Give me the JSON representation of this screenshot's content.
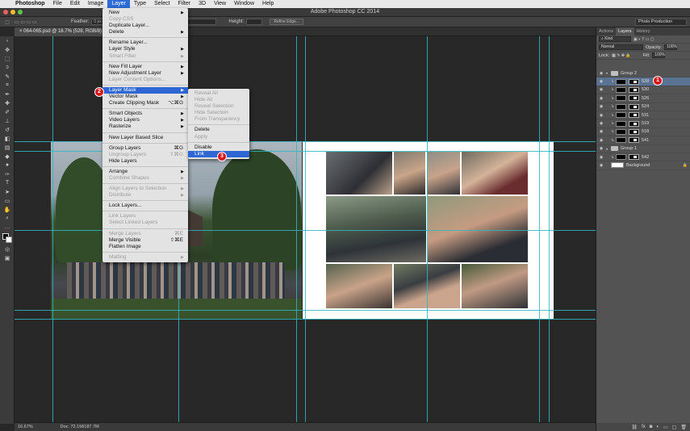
{
  "menubar": {
    "app": "Photoshop",
    "items": [
      "File",
      "Edit",
      "Image",
      "Layer",
      "Type",
      "Select",
      "Filter",
      "3D",
      "View",
      "Window",
      "Help"
    ],
    "active": "Layer"
  },
  "window": {
    "title": "Adobe Photoshop CC 2014"
  },
  "options_bar": {
    "feather_label": "Feather:",
    "feather_value": "0 px",
    "height_label": "Height:",
    "refine_edge": "Refine Edge..."
  },
  "workspace": "Photo Production",
  "document_tab": "064-065.psd @ 16.7% (528, RGB/8)",
  "status": {
    "zoom": "16.67%",
    "doc": "Doc: 72.1M/187.7M"
  },
  "layer_menu": {
    "items": [
      {
        "label": "New",
        "sub": true
      },
      {
        "label": "Copy CSS",
        "disabled": true
      },
      {
        "label": "Duplicate Layer..."
      },
      {
        "label": "Delete",
        "sub": true
      },
      {
        "sep": true
      },
      {
        "label": "Rename Layer..."
      },
      {
        "label": "Layer Style",
        "sub": true
      },
      {
        "label": "Smart Filter",
        "disabled": true,
        "sub": true
      },
      {
        "sep": true
      },
      {
        "label": "New Fill Layer",
        "sub": true
      },
      {
        "label": "New Adjustment Layer",
        "sub": true
      },
      {
        "label": "Layer Content Options...",
        "disabled": true
      },
      {
        "sep": true
      },
      {
        "label": "Layer Mask",
        "sub": true,
        "hl": true
      },
      {
        "label": "Vector Mask",
        "sub": true
      },
      {
        "label": "Create Clipping Mask",
        "shortcut": "⌥⌘G"
      },
      {
        "sep": true
      },
      {
        "label": "Smart Objects",
        "sub": true
      },
      {
        "label": "Video Layers",
        "sub": true
      },
      {
        "label": "Rasterize",
        "sub": true
      },
      {
        "sep": true
      },
      {
        "label": "New Layer Based Slice"
      },
      {
        "sep": true
      },
      {
        "label": "Group Layers",
        "shortcut": "⌘G"
      },
      {
        "label": "Ungroup Layers",
        "shortcut": "⇧⌘G",
        "disabled": true
      },
      {
        "label": "Hide Layers"
      },
      {
        "sep": true
      },
      {
        "label": "Arrange",
        "sub": true
      },
      {
        "label": "Combine Shapes",
        "sub": true,
        "disabled": true
      },
      {
        "sep": true
      },
      {
        "label": "Align Layers to Selection",
        "sub": true,
        "disabled": true
      },
      {
        "label": "Distribute",
        "sub": true,
        "disabled": true
      },
      {
        "sep": true
      },
      {
        "label": "Lock Layers..."
      },
      {
        "sep": true
      },
      {
        "label": "Link Layers",
        "disabled": true
      },
      {
        "label": "Select Linked Layers",
        "disabled": true
      },
      {
        "sep": true
      },
      {
        "label": "Merge Layers",
        "shortcut": "⌘E",
        "disabled": true
      },
      {
        "label": "Merge Visible",
        "shortcut": "⇧⌘E"
      },
      {
        "label": "Flatten Image"
      },
      {
        "sep": true
      },
      {
        "label": "Matting",
        "sub": true,
        "disabled": true
      }
    ]
  },
  "mask_submenu": {
    "items": [
      {
        "label": "Reveal All",
        "disabled": true
      },
      {
        "label": "Hide All",
        "disabled": true
      },
      {
        "label": "Reveal Selection",
        "disabled": true
      },
      {
        "label": "Hide Selection",
        "disabled": true
      },
      {
        "label": "From Transparency",
        "disabled": true
      },
      {
        "sep": true
      },
      {
        "label": "Delete"
      },
      {
        "label": "Apply",
        "disabled": true
      },
      {
        "sep": true
      },
      {
        "label": "Disable"
      },
      {
        "label": "Link",
        "hl": true
      }
    ]
  },
  "markers": [
    "1",
    "2",
    "3"
  ],
  "panel": {
    "tabs": [
      "Actions",
      "Layers",
      "History"
    ],
    "active_tab": "Layers",
    "filter": "Kind",
    "blend": "Normal",
    "opacity_label": "Opacity:",
    "opacity": "100%",
    "lock_label": "Lock:",
    "fill_label": "Fill:",
    "fill": "100%",
    "layers": [
      {
        "name": "Group 2",
        "type": "group"
      },
      {
        "name": "528",
        "type": "mask",
        "selected": true
      },
      {
        "name": "530",
        "type": "mask"
      },
      {
        "name": "526",
        "type": "mask"
      },
      {
        "name": "524",
        "type": "mask"
      },
      {
        "name": "531",
        "type": "mask"
      },
      {
        "name": "519",
        "type": "mask"
      },
      {
        "name": "518",
        "type": "mask"
      },
      {
        "name": "541",
        "type": "mask"
      },
      {
        "name": "Group 1",
        "type": "group"
      },
      {
        "name": "542",
        "type": "mask"
      },
      {
        "name": "Background",
        "type": "bg"
      }
    ]
  },
  "colors": {
    "accent": "#2e67d3",
    "guide": "#2fb7c2",
    "marker": "#d4161c"
  }
}
